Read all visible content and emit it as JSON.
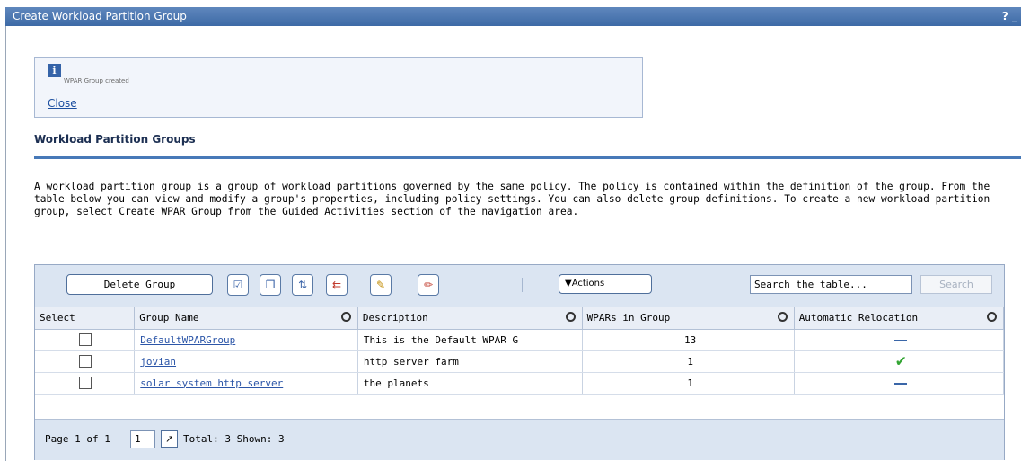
{
  "window": {
    "title": "Create Workload Partition Group",
    "help_icons": "? _"
  },
  "message": {
    "icon": "info-icon",
    "text": "WPAR Group created",
    "close_label": "Close"
  },
  "section": {
    "title": "Workload Partition Groups",
    "description": "A workload partition group is a group of workload partitions governed by the same policy. The policy is contained within the definition of the group. From the table below you can view and modify a group's properties, including policy settings. You can also delete group definitions. To create a new workload partition group, select Create WPAR Group from the Guided Activities section of the navigation area."
  },
  "toolbar": {
    "delete_label": "Delete Group",
    "icons": [
      "select-all-icon",
      "deselect-all-icon",
      "show-filter-icon",
      "clear-filter-icon",
      "edit-sort-icon",
      "clear-sort-icon"
    ],
    "actions_label": "▼Actions",
    "search_value": "Search the table...",
    "search_button": "Search"
  },
  "table": {
    "columns": [
      "Select",
      "Group Name",
      "Description",
      "WPARs in Group",
      "Automatic Relocation"
    ],
    "rows": [
      {
        "name": "DefaultWPARGroup",
        "description": "This is the Default WPAR G",
        "wpars": "13",
        "relocation": "none"
      },
      {
        "name": "jovian",
        "description": "http server farm",
        "wpars": "1",
        "relocation": "yes"
      },
      {
        "name": "solar system http server",
        "description": "the planets",
        "wpars": "1",
        "relocation": "none"
      }
    ]
  },
  "pager": {
    "page_label": "Page 1 of 1",
    "page_value": "1",
    "total_text": "Total: 3 Shown: 3"
  }
}
